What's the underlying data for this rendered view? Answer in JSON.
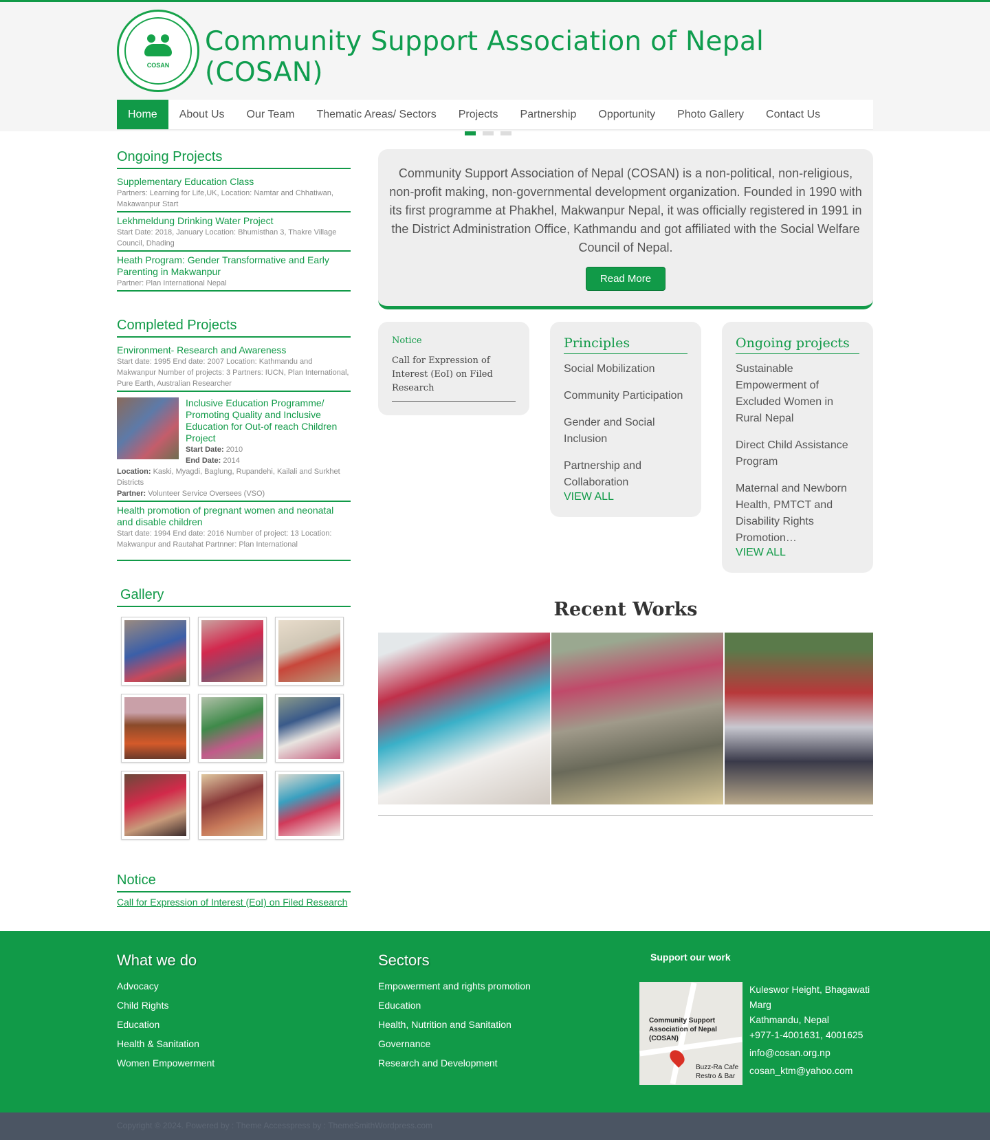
{
  "site": {
    "title": "Community Support Association of Nepal (COSAN)",
    "logo_ring_text": "Community Support Association of Nepal",
    "logo_small_text": "COSAN"
  },
  "nav": [
    {
      "label": "Home",
      "active": true
    },
    {
      "label": "About Us"
    },
    {
      "label": "Our Team"
    },
    {
      "label": "Thematic Areas/ Sectors"
    },
    {
      "label": "Projects"
    },
    {
      "label": "Partnership"
    },
    {
      "label": "Opportunity"
    },
    {
      "label": "Photo Gallery"
    },
    {
      "label": "Contact Us"
    }
  ],
  "ongoing": {
    "title": "Ongoing Projects",
    "items": [
      {
        "title": "Supplementary Education Class",
        "meta": "Partners: Learning for Life,UK,  Location: Namtar and Chhatiwan, Makawanpur Start"
      },
      {
        "title": "Lekhmeldung Drinking Water Project",
        "meta": "Start Date: 2018, January Location: Bhumisthan 3, Thakre Village Council, Dhading"
      },
      {
        "title": "Heath Program: Gender Transformative and Early Parenting in Makwanpur",
        "meta": "Partner: Plan International Nepal"
      }
    ]
  },
  "completed": {
    "title": "Completed Projects",
    "item1": {
      "title": "Environment- Research and Awareness",
      "meta": "Start date: 1995 End date: 2007 Location: Kathmandu and Makwanpur Number of projects: 3 Partners: IUCN, Plan International, Pure Earth, Australian Researcher"
    },
    "item2": {
      "title": "Inclusive Education Programme/ Promoting Quality and Inclusive Education for Out-of reach Children Project",
      "start_label": "Start Date:",
      "start": "2010",
      "end_label": "End Date:",
      "end": "2014",
      "location_label": "Location:",
      "location": "Kaski, Myagdi, Baglung, Rupandehi, Kailali and Surkhet Districts",
      "partner_label": "Partner:",
      "partner": "Volunteer Service Oversees (VSO)"
    },
    "item3": {
      "title": "Health promotion of pregnant women and neonatal and disable children",
      "meta": "Start date: 1994 End date: 2016 Number of project: 13 Location: Makwanpur and Rautahat Partnner: Plan International"
    }
  },
  "gallery": {
    "title": "Gallery"
  },
  "notice_left": {
    "title": "Notice",
    "link": "Call for Expression of Interest (EoI) on Filed Research"
  },
  "intro": {
    "text": "Community Support Association of Nepal (COSAN) is a non-political, non-religious, non-profit making, non-governmental development organization. Founded in 1990 with its first programme at Phakhel, Makwanpur Nepal, it was officially registered in 1991 in the District Administration Office, Kathmandu and got affiliated with the Social Welfare Council of Nepal.",
    "button": "Read More"
  },
  "notice_card": {
    "title": "Notice",
    "body": "Call for Expression of Interest (EoI) on Filed Research"
  },
  "principles": {
    "title": "Principles",
    "items": [
      "Social Mobilization",
      "Community Participation",
      "Gender and Social Inclusion",
      "Partnership and Collaboration"
    ],
    "view_all": "VIEW ALL"
  },
  "ongoing_card": {
    "title": "Ongoing projects",
    "items": [
      "Sustainable Empowerment of Excluded Women in Rural Nepal",
      "Direct Child Assistance Program",
      "Maternal and Newborn Health, PMTCT and Disability Rights Promotion…"
    ],
    "view_all": "VIEW ALL"
  },
  "recent": {
    "title": "Recent Works"
  },
  "footer": {
    "what_title": "What we do",
    "what_items": [
      "Advocacy",
      "Child Rights",
      "Education",
      "Health & Sanitation",
      "Women Empowerment"
    ],
    "sectors_title": "Sectors",
    "sectors_items": [
      "Empowerment and rights promotion",
      "Education",
      "Health, Nutrition and Sanitation",
      "Governance",
      "Research and Development"
    ],
    "support_title": "Support our work",
    "map_label": "Community Support Association of Nepal (COSAN)",
    "map_place": "Buzz-Ra Cafe Restro & Bar",
    "address1": "Kuleswor Height, Bhagawati Marg",
    "address2": "Kathmandu, Nepal",
    "phone": "+977-1-4001631, 4001625",
    "email1": "info@cosan.org.np",
    "email2": "cosan_ktm@yahoo.com"
  },
  "copyright": "Copyright © 2024. Powered by : Theme Accesspress by : ThemeSmithWordpress.com"
}
